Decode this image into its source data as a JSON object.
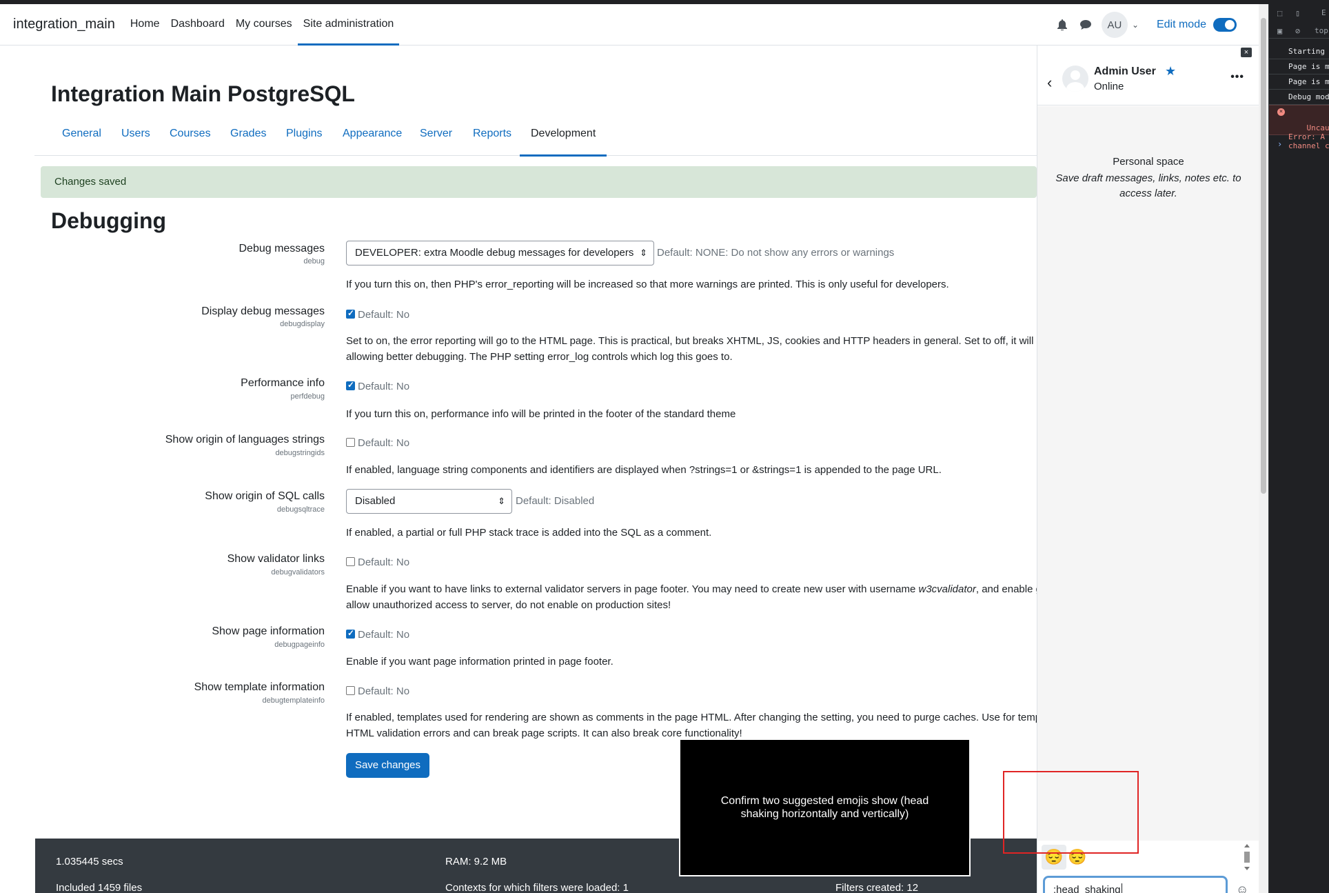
{
  "navbar": {
    "brand": "integration_main",
    "links": [
      "Home",
      "Dashboard",
      "My courses",
      "Site administration"
    ],
    "avatar_initials": "AU",
    "edit_mode_label": "Edit mode"
  },
  "page": {
    "title": "Integration Main PostgreSQL",
    "tabs": [
      "General",
      "Users",
      "Courses",
      "Grades",
      "Plugins",
      "Appearance",
      "Server",
      "Reports",
      "Development"
    ],
    "active_tab": "Development",
    "alert": "Changes saved",
    "section_title": "Debugging"
  },
  "settings": {
    "debug": {
      "label": "Debug messages",
      "key": "debug",
      "value": "DEVELOPER: extra Moodle debug messages for developers",
      "default": "Default: NONE: Do not show any errors or warnings",
      "desc": "If you turn this on, then PHP's error_reporting will be increased so that more warnings are printed. This is only useful for developers."
    },
    "debugdisplay": {
      "label": "Display debug messages",
      "key": "debugdisplay",
      "checked": true,
      "default": "Default: No",
      "desc1": "Set to on, the error reporting will go to the HTML page. This is practical, but breaks XHTML, JS, cookies and HTTP headers in general. Set to off, it will s",
      "desc2": "allowing better debugging. The PHP setting error_log controls which log this goes to."
    },
    "perfdebug": {
      "label": "Performance info",
      "key": "perfdebug",
      "checked": true,
      "default": "Default: No",
      "desc": "If you turn this on, performance info will be printed in the footer of the standard theme"
    },
    "debugstringids": {
      "label": "Show origin of languages strings",
      "key": "debugstringids",
      "checked": false,
      "default": "Default: No",
      "desc": "If enabled, language string components and identifiers are displayed when ?strings=1 or &strings=1 is appended to the page URL."
    },
    "debugsqltrace": {
      "label": "Show origin of SQL calls",
      "key": "debugsqltrace",
      "value": "Disabled",
      "default": "Default: Disabled",
      "desc": "If enabled, a partial or full PHP stack trace is added into the SQL as a comment."
    },
    "debugvalidators": {
      "label": "Show validator links",
      "key": "debugvalidators",
      "checked": false,
      "default": "Default: No",
      "desc1_a": "Enable if you want to have links to external validator servers in page footer. You may need to create new user with username ",
      "desc1_b": "w3cvalidator",
      "desc1_c": ", and enable g",
      "desc2": "allow unauthorized access to server, do not enable on production sites!"
    },
    "debugpageinfo": {
      "label": "Show page information",
      "key": "debugpageinfo",
      "checked": true,
      "default": "Default: No",
      "desc": "Enable if you want page information printed in page footer."
    },
    "debugtemplateinfo": {
      "label": "Show template information",
      "key": "debugtemplateinfo",
      "checked": false,
      "default": "Default: No",
      "desc1": "If enabled, templates used for rendering are shown as comments in the page HTML. After changing the setting, you need to purge caches. Use for temp",
      "desc2": "HTML validation errors and can break page scripts. It can also break core functionality!"
    },
    "save_label": "Save changes"
  },
  "footer": {
    "secs": "1.035445 secs",
    "ram": "RAM: 9.2 MB",
    "files": "Included 1459 files",
    "contexts": "Contexts for which filters were loaded: 1",
    "filters": "Filters created: 12"
  },
  "overlay": {
    "text": "Confirm two suggested emojis show (head shaking horizontally and vertically)"
  },
  "drawer": {
    "close": "×",
    "user_name": "Admin User",
    "status": "Online",
    "personal_space_title": "Personal space",
    "personal_space_sub": "Save draft messages, links, notes etc. to access later.",
    "emoji_suggestions": [
      "😔",
      "😔"
    ],
    "compose_value": ":head_shaking"
  },
  "devtools": {
    "toolbar_text": "top",
    "toolbar_text2": "E",
    "lines": [
      "Starting",
      "Page is m",
      "Page is m",
      "Debug mod"
    ],
    "error": "Uncaught\nError: A\nchannel c",
    "prompt": "›"
  },
  "colors": {
    "accent": "#0f6cbf",
    "alert_bg": "#d7e6d8",
    "footer_bg": "#343a40",
    "highlight": "#e02424"
  }
}
